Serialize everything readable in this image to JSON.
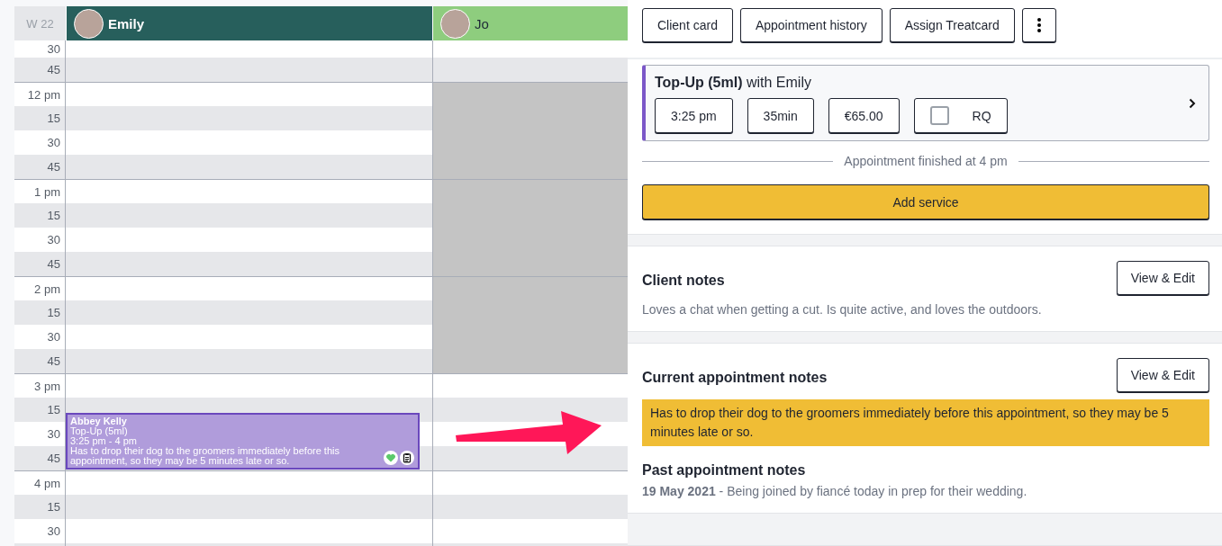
{
  "calendar": {
    "week_label": "W 22",
    "staff": [
      {
        "name": "Emily",
        "color": "#275f5c"
      },
      {
        "name": "Jo",
        "color": "#8ecd7e"
      }
    ],
    "slots": [
      {
        "label": "30",
        "shaded": false,
        "blocked": [
          false,
          false
        ]
      },
      {
        "label": "45",
        "shaded": true,
        "blocked": [
          false,
          false
        ]
      },
      {
        "label": "12 pm",
        "shaded": false,
        "hour": true,
        "blocked": [
          false,
          true
        ]
      },
      {
        "label": "15",
        "shaded": true,
        "blocked": [
          false,
          true
        ]
      },
      {
        "label": "30",
        "shaded": false,
        "blocked": [
          false,
          true
        ]
      },
      {
        "label": "45",
        "shaded": true,
        "blocked": [
          false,
          true
        ]
      },
      {
        "label": "1 pm",
        "shaded": false,
        "hour": true,
        "blocked": [
          false,
          true
        ]
      },
      {
        "label": "15",
        "shaded": true,
        "blocked": [
          false,
          true
        ]
      },
      {
        "label": "30",
        "shaded": false,
        "blocked": [
          false,
          true
        ]
      },
      {
        "label": "45",
        "shaded": true,
        "blocked": [
          false,
          true
        ]
      },
      {
        "label": "2 pm",
        "shaded": false,
        "hour": true,
        "blocked": [
          false,
          true
        ]
      },
      {
        "label": "15",
        "shaded": true,
        "blocked": [
          false,
          true
        ]
      },
      {
        "label": "30",
        "shaded": false,
        "blocked": [
          false,
          true
        ]
      },
      {
        "label": "45",
        "shaded": true,
        "blocked": [
          false,
          true
        ]
      },
      {
        "label": "3 pm",
        "shaded": false,
        "hour": true,
        "blocked": [
          false,
          false
        ]
      },
      {
        "label": "15",
        "shaded": true,
        "blocked": [
          false,
          false
        ],
        "appointment": {
          "client": "Abbey Kelly",
          "service": "Top-Up (5ml)",
          "time": "3:25 pm - 4 pm",
          "note": "Has to drop their dog to the groomers immediately before this appointment, so they may be 5 minutes late or so."
        }
      },
      {
        "label": "30",
        "shaded": false,
        "blocked": [
          false,
          false
        ]
      },
      {
        "label": "45",
        "shaded": true,
        "blocked": [
          false,
          false
        ]
      },
      {
        "label": "4 pm",
        "shaded": false,
        "hour": true,
        "blocked": [
          false,
          false
        ]
      },
      {
        "label": "15",
        "shaded": true,
        "blocked": [
          false,
          false
        ]
      },
      {
        "label": "30",
        "shaded": false,
        "blocked": [
          false,
          false
        ]
      },
      {
        "shaded": true,
        "blocked": [
          false,
          false
        ]
      }
    ]
  },
  "panel": {
    "actions": [
      "Client card",
      "Appointment history",
      "Assign Treatcard"
    ],
    "service": {
      "name": "Top-Up (5ml)",
      "staff_text": "with Emily",
      "time": "3:25 pm",
      "duration": "35min",
      "price": "€65.00",
      "rq_label": "RQ",
      "rq_checked": false
    },
    "finished_text": "Appointment finished at 4 pm",
    "add_service": "Add service",
    "client_notes": {
      "title": "Client notes",
      "button": "View & Edit",
      "text": "Loves a chat when getting a cut. Is quite active, and loves the outdoors."
    },
    "current_notes": {
      "title": "Current appointment notes",
      "button": "View & Edit",
      "text": "Has to drop their dog to the groomers immediately before this appointment, so they may be 5 minutes late or so."
    },
    "past_notes": {
      "title": "Past appointment notes",
      "entries": [
        {
          "date": "19 May 2021",
          "text": " - Being joined by fiancé today in prep for their wedding."
        }
      ]
    }
  }
}
